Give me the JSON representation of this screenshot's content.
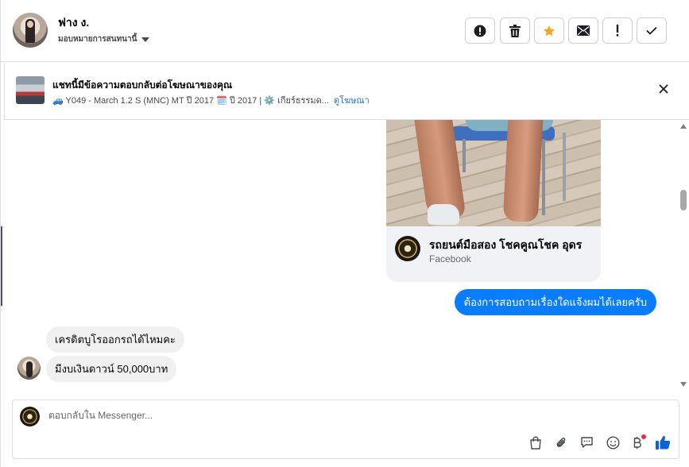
{
  "header": {
    "user_name": "ฟาง ง.",
    "assign_label": "มอบหมายการสนทนานี้",
    "tools": [
      {
        "name": "spam-icon",
        "label": "Mark as spam"
      },
      {
        "name": "trash-icon",
        "label": "Delete"
      },
      {
        "name": "star-icon",
        "label": "Star"
      },
      {
        "name": "envelope-icon",
        "label": "Mark unread"
      },
      {
        "name": "exclamation-icon",
        "label": "Follow up"
      },
      {
        "name": "check-icon",
        "label": "Done"
      }
    ],
    "star_color": "#f5a623"
  },
  "ad": {
    "title": "แชทนี้มีข้อความตอบกลับต่อโฆษณาของคุณ",
    "subtitle": "🚙 Y049 - March 1.2 S (MNC) MT ปี 2017 🗓️ ปี 2017 | ⚙️ เกียร์ธรรมด...",
    "link": "ดูโฆษณา"
  },
  "card": {
    "page_name": "รถยนต์มือสอง โชคคูณโชค อุดร",
    "source": "Facebook"
  },
  "messages": {
    "outgoing": "ต้องการสอบถามเรื่องใดแจ้งผมได้เลยครับ",
    "incoming": [
      "เครดิตบูโรออกรถได้ไหมคะ",
      "มีงบเงินดาวน์ 50,000บาท"
    ]
  },
  "composer": {
    "placeholder": "ตอบกลับใน Messenger...",
    "icons": [
      "shopping-bag-icon",
      "paperclip-icon",
      "saved-reply-icon",
      "emoji-icon",
      "baht-icon",
      "thumbs-up-icon"
    ],
    "accent": "#0a7cff"
  }
}
